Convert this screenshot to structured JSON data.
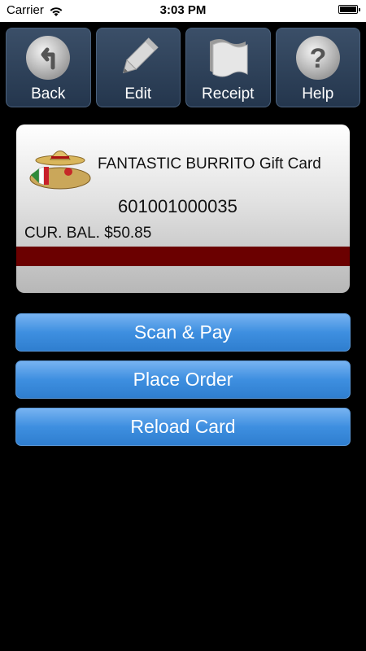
{
  "status_bar": {
    "carrier": "Carrier",
    "time": "3:03 PM"
  },
  "toolbar": {
    "back_label": "Back",
    "edit_label": "Edit",
    "receipt_label": "Receipt",
    "help_label": "Help"
  },
  "card": {
    "title": "FANTASTIC BURRITO Gift Card",
    "number": "601001000035",
    "balance": "CUR. BAL. $50.85",
    "stripe_color": "#6b0000"
  },
  "actions": {
    "scan_pay": "Scan & Pay",
    "place_order": "Place Order",
    "reload_card": "Reload Card"
  },
  "colors": {
    "accent_blue": "#3e8fe0",
    "toolbar_bg": "#2f425a"
  }
}
